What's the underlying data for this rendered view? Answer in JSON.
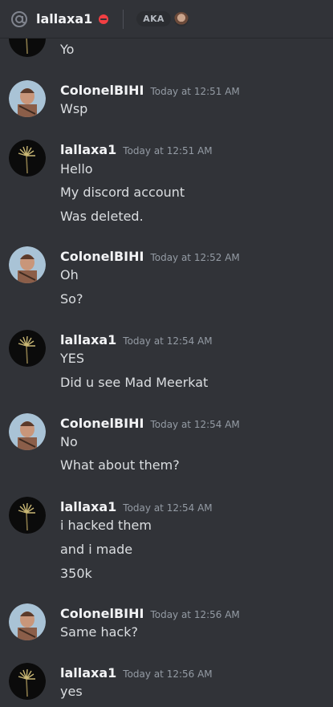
{
  "topbar": {
    "username": "lallaxa1",
    "aka_label": "AKA"
  },
  "partial_message": {
    "text": "Yo"
  },
  "messages": [
    {
      "author": "ColonelBIHI",
      "time": "Today at 12:51 AM",
      "lines": [
        "Wsp"
      ]
    },
    {
      "author": "lallaxa1",
      "time": "Today at 12:51 AM",
      "lines": [
        "Hello",
        "My discord account",
        "Was deleted."
      ]
    },
    {
      "author": "ColonelBIHI",
      "time": "Today at 12:52 AM",
      "lines": [
        "Oh",
        "So?"
      ]
    },
    {
      "author": "lallaxa1",
      "time": "Today at 12:54 AM",
      "lines": [
        "YES",
        "Did u see Mad Meerkat"
      ]
    },
    {
      "author": "ColonelBIHI",
      "time": "Today at 12:54 AM",
      "lines": [
        "No",
        "What about them?"
      ]
    },
    {
      "author": "lallaxa1",
      "time": "Today at 12:54 AM",
      "lines": [
        "i hacked them",
        "and i made",
        "350k"
      ]
    },
    {
      "author": "ColonelBIHI",
      "time": "Today at 12:56 AM",
      "lines": [
        "Same hack?"
      ]
    },
    {
      "author": "lallaxa1",
      "time": "Today at 12:56 AM",
      "lines": [
        "yes"
      ]
    }
  ]
}
